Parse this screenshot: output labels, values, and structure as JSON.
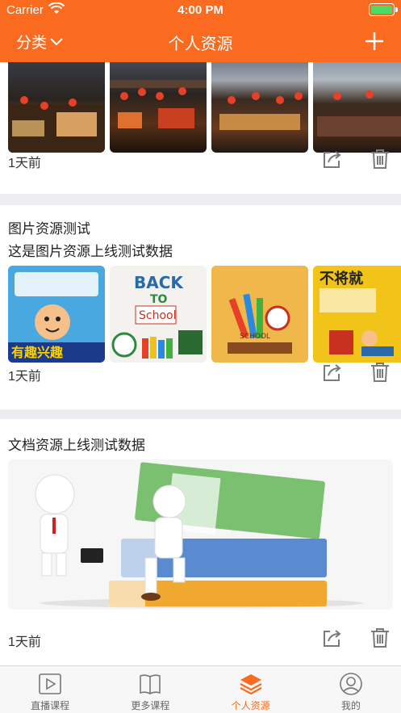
{
  "status": {
    "carrier": "Carrier",
    "time": "4:00 PM"
  },
  "nav": {
    "category_label": "分类",
    "title": "个人资源"
  },
  "cards": [
    {
      "time": "1天前"
    },
    {
      "title": "图片资源测试",
      "desc": "这是图片资源上线测试数据",
      "time": "1天前"
    },
    {
      "title": "文档资源上线测试数据",
      "time": "1天前"
    }
  ],
  "tabs": [
    {
      "label": "直播课程",
      "icon": "play-icon"
    },
    {
      "label": "更多课程",
      "icon": "book-icon"
    },
    {
      "label": "个人资源",
      "icon": "layers-icon"
    },
    {
      "label": "我的",
      "icon": "user-icon"
    }
  ],
  "colors": {
    "accent": "#fa6a1f",
    "page_bg": "#ececf1",
    "battery": "#4cd964"
  }
}
